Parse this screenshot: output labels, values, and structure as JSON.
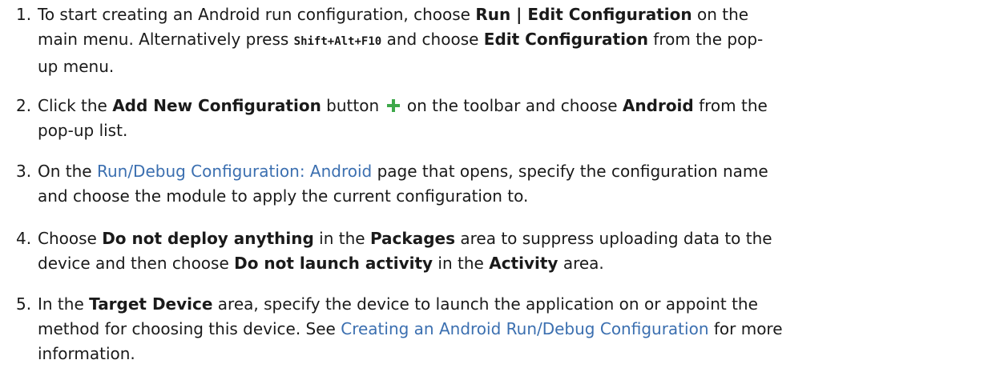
{
  "steps": [
    {
      "number": "1.",
      "line1_a": "To start creating an Android run configuration, choose ",
      "line1_b": "Run | Edit Configuration",
      "line1_c": " on the",
      "line2_a": "main menu. Alternatively press ",
      "line2_b": "Shift+Alt+F10",
      "line2_c": " and choose ",
      "line2_d": "Edit Configuration",
      "line2_e": " from the pop-",
      "line3_a": "up menu."
    },
    {
      "number": "2.",
      "line1_a": "Click the ",
      "line1_b": "Add New Configuration",
      "line1_c": " button ",
      "icon": "plus-icon",
      "icon_color": "#3ea84a",
      "line1_d": " on the toolbar and choose ",
      "line1_e": "Android",
      "line1_f": " from the",
      "line2_a": "pop-up list."
    },
    {
      "number": "3.",
      "line1_a": "On the ",
      "link": "Run/Debug Configuration: Android",
      "line1_b": " page that opens, specify the configuration name",
      "line2_a": "and choose the module to apply the current configuration to."
    },
    {
      "number": "4.",
      "line1_a": "Choose ",
      "line1_b": "Do not deploy anything",
      "line1_c": " in the ",
      "line1_d": "Packages",
      "line1_e": " area to suppress uploading data to the",
      "line2_a": "device and then choose ",
      "line2_b": "Do not launch activity",
      "line2_c": " in the ",
      "line2_d": "Activity",
      "line2_e": " area."
    },
    {
      "number": "5.",
      "line1_a": "In the ",
      "line1_b": "Target Device",
      "line1_c": " area, specify the device to launch the application on or appoint the",
      "line2_a": "method for choosing this device. See ",
      "link": "Creating an Android Run/Debug Configuration",
      "line2_b": " for more",
      "line3_a": "information."
    }
  ],
  "colors": {
    "link": "#3b6fb0",
    "text": "#1a1a1a"
  }
}
